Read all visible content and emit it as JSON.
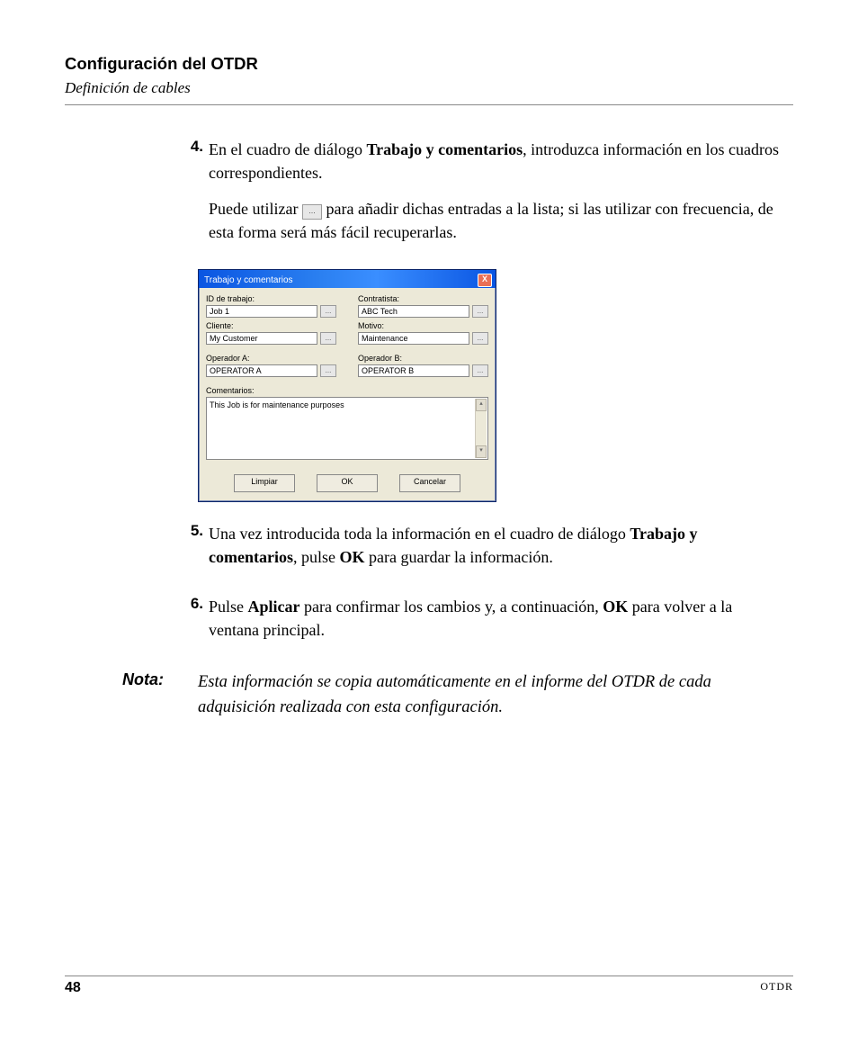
{
  "header": {
    "title": "Configuración del OTDR",
    "subtitle": "Definición de cables"
  },
  "steps": {
    "s4": {
      "num": "4.",
      "p1_a": "En el cuadro de diálogo ",
      "p1_bold": "Trabajo y comentarios",
      "p1_b": ", introduzca información en los cuadros correspondientes.",
      "p2_a": "Puede utilizar ",
      "p2_btn": "...",
      "p2_b": " para añadir dichas entradas a la lista; si las utilizar con frecuencia, de esta forma será más fácil recuperarlas."
    },
    "s5": {
      "num": "5.",
      "p1_a": "Una vez introducida toda la información en el cuadro de diálogo ",
      "p1_bold": "Trabajo y comentarios",
      "p1_b": ", pulse ",
      "p1_bold2": "OK",
      "p1_c": " para guardar la información."
    },
    "s6": {
      "num": "6.",
      "p1_a": "Pulse ",
      "p1_bold": "Aplicar",
      "p1_b": " para confirmar los cambios y, a continuación, ",
      "p1_bold2": "OK",
      "p1_c": " para volver a la ventana principal."
    }
  },
  "dialog": {
    "title": "Trabajo y comentarios",
    "close": "X",
    "fields": {
      "jobid": {
        "label": "ID de trabajo:",
        "value": "Job 1"
      },
      "contractor": {
        "label": "Contratista:",
        "value": "ABC Tech"
      },
      "client": {
        "label": "Cliente:",
        "value": "My Customer"
      },
      "reason": {
        "label": "Motivo:",
        "value": "Maintenance"
      },
      "opA": {
        "label": "Operador A:",
        "value": "OPERATOR A"
      },
      "opB": {
        "label": "Operador B:",
        "value": "OPERATOR B"
      }
    },
    "comments_label": "Comentarios:",
    "comments_value": "This Job is for maintenance purposes",
    "dot": "...",
    "buttons": {
      "clear": "Limpiar",
      "ok": "OK",
      "cancel": "Cancelar"
    }
  },
  "note": {
    "label": "Nota:",
    "text": "Esta información se copia automáticamente en el informe del OTDR de cada adquisición realizada con esta configuración."
  },
  "footer": {
    "page": "48",
    "product": "OTDR"
  }
}
